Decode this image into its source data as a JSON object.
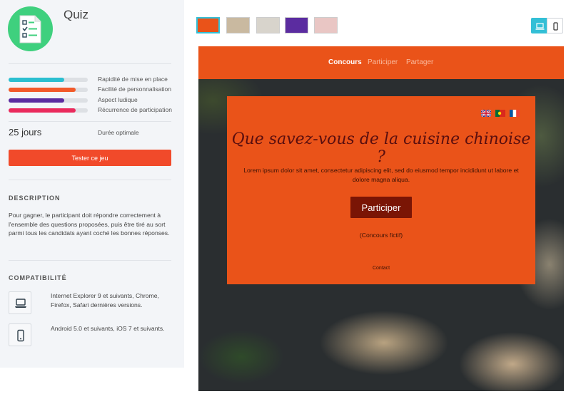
{
  "sidebar": {
    "title": "Quiz",
    "ratings": [
      {
        "label": "Rapidité de mise en place",
        "level": 0.7,
        "color": "#2bbfd0"
      },
      {
        "label": "Facilité de personnalisation",
        "level": 0.85,
        "color": "#f25a2a"
      },
      {
        "label": "Aspect ludique",
        "level": 0.7,
        "color": "#5b2ca0"
      },
      {
        "label": "Récurrence de participation",
        "level": 0.85,
        "color": "#ea2a5c"
      }
    ],
    "duration_value": "25 jours",
    "duration_label": "Durée optimale",
    "try_button_label": "Tester ce jeu",
    "description_title": "DESCRIPTION",
    "description_text": "Pour gagner, le participant doit répondre correctement à l'ensemble des questions proposées, puis être tiré au sort parmi tous les candidats ayant coché les bonnes réponses.",
    "compat_title": "COMPATIBILITÉ",
    "compat_desktop_text": "Internet Explorer 9 et suivants, Chrome, Firefox, Safari dernières versions.",
    "compat_mobile_text": "Android 5.0 et suivants, iOS 7 et suivants.",
    "icons": {
      "logo": "quiz-checklist-icon",
      "desktop": "laptop-icon",
      "mobile": "smartphone-icon"
    }
  },
  "toolbar": {
    "thumbnails": [
      {
        "name": "thumbnail-1",
        "color": "#ea5319",
        "active": true
      },
      {
        "name": "thumbnail-2",
        "color": "#c9b9a0",
        "active": false
      },
      {
        "name": "thumbnail-3",
        "color": "#d8d4cc",
        "active": false
      },
      {
        "name": "thumbnail-4",
        "color": "#5b2ca0",
        "active": false
      },
      {
        "name": "thumbnail-5",
        "color": "#e9c6c4",
        "active": false
      }
    ],
    "device_desktop_icon": "laptop-icon",
    "device_mobile_icon": "smartphone-icon",
    "selected_device": "desktop"
  },
  "preview": {
    "nav": [
      "Concours",
      "Participer",
      "Partager"
    ],
    "active_nav": "Concours",
    "flags": [
      "uk-flag-icon",
      "portugal-flag-icon",
      "france-flag-icon"
    ],
    "title": "Que savez-vous de la cuisine chinoise ?",
    "lorem": "Lorem ipsum dolor sit amet, consectetur adipiscing elit, sed do eiusmod tempor incididunt ut labore et dolore magna aliqua.",
    "participer_button": "Participer",
    "fictif_note": "(Concours fictif)",
    "contact": "Contact",
    "accent_color": "#ea5319"
  }
}
